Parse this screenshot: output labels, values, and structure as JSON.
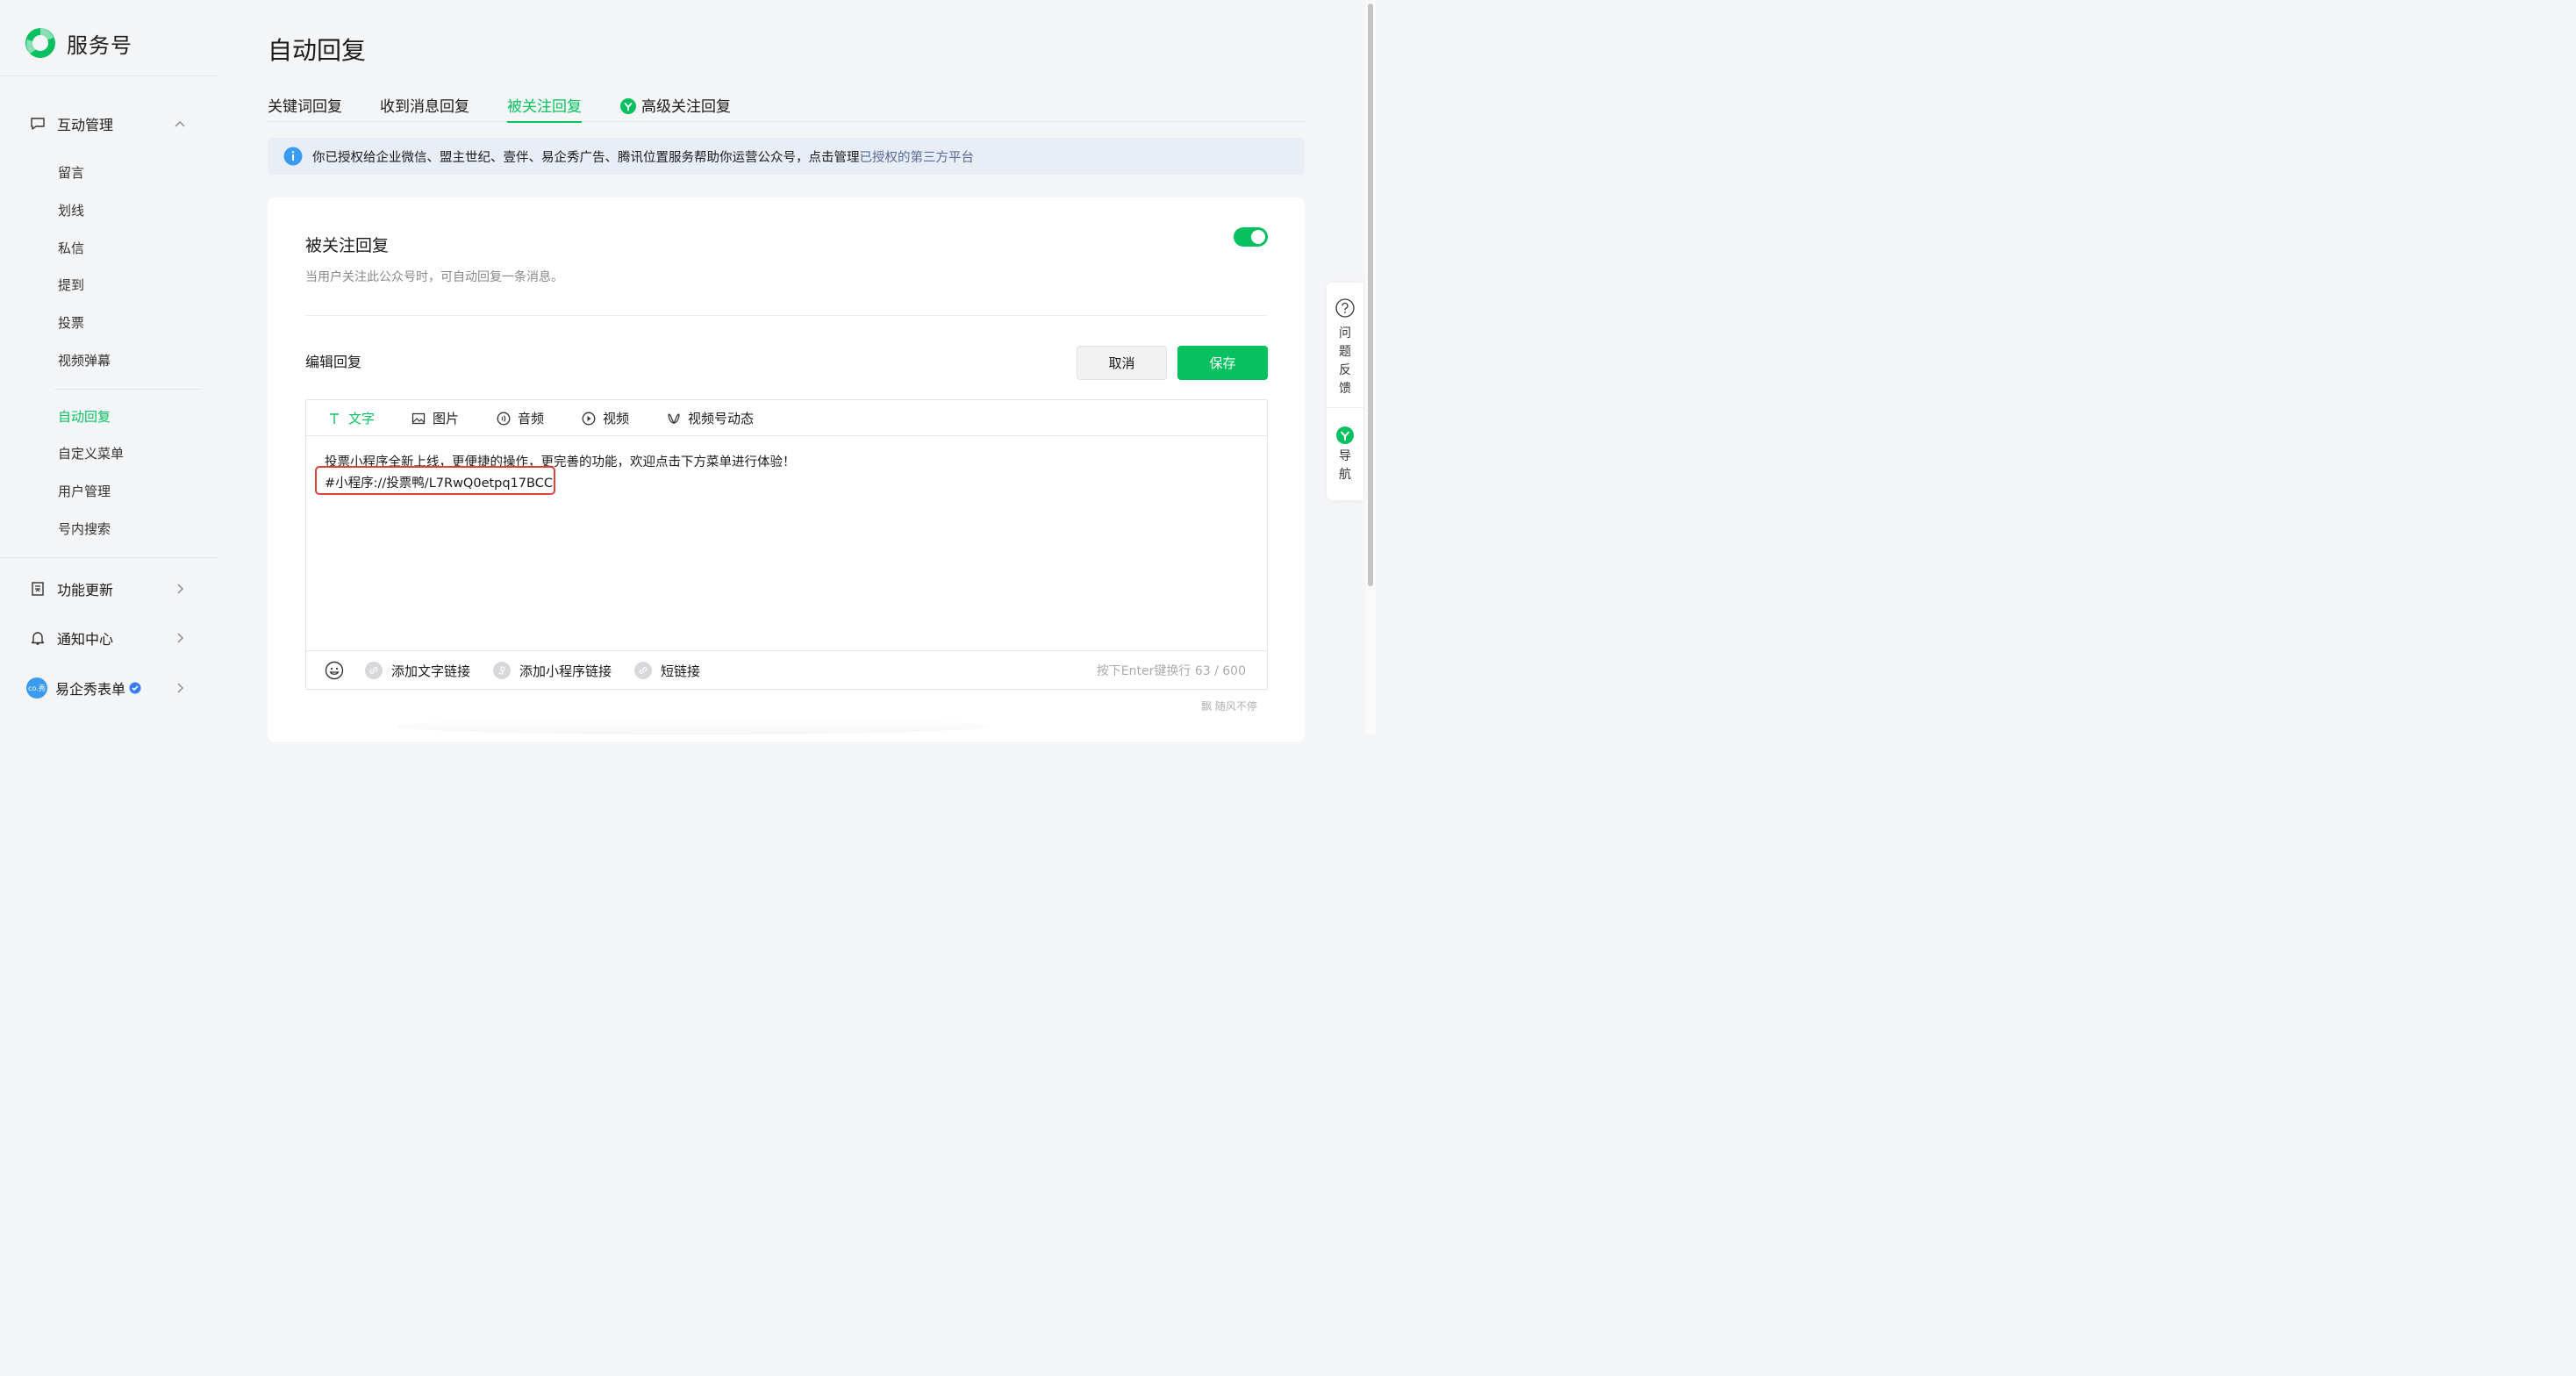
{
  "brand": {
    "name": "服务号"
  },
  "sidebar": {
    "groups": [
      {
        "label": "互动管理"
      },
      {
        "label": "功能更新"
      },
      {
        "label": "通知中心"
      },
      {
        "label": "易企秀表单"
      }
    ],
    "items": [
      "留言",
      "划线",
      "私信",
      "提到",
      "投票",
      "视频弹幕",
      "自动回复",
      "自定义菜单",
      "用户管理",
      "号内搜索"
    ],
    "avatar_text": "co.秀"
  },
  "page": {
    "title": "自动回复"
  },
  "tabs": [
    "关键词回复",
    "收到消息回复",
    "被关注回复",
    "高级关注回复"
  ],
  "notice": {
    "text": "你已授权给企业微信、盟主世纪、壹伴、易企秀广告、腾讯位置服务帮助你运营公众号，点击管理",
    "link": "已授权的第三方平台"
  },
  "card": {
    "title": "被关注回复",
    "desc": "当用户关注此公众号时，可自动回复一条消息。",
    "edit_label": "编辑回复",
    "cancel": "取消",
    "save": "保存",
    "toolbar": [
      "文字",
      "图片",
      "音频",
      "视频",
      "视频号动态"
    ],
    "content_line1": "投票小程序全新上线，更便捷的操作，更完善的功能，欢迎点击下方菜单进行体验！",
    "content_line2": "#小程序://投票鸭/L7RwQ0etpq17BCC",
    "footer": [
      "添加文字链接",
      "添加小程序链接",
      "短链接"
    ],
    "counter": "按下Enter键换行 63 / 600",
    "watermark": "飘 随风不停"
  },
  "float_panel": {
    "feedback": [
      "问",
      "题",
      "反",
      "馈"
    ],
    "nav": [
      "导",
      "航"
    ]
  },
  "colors": {
    "accent": "#07c160",
    "link": "#576b95",
    "highlight": "#d9453b"
  }
}
